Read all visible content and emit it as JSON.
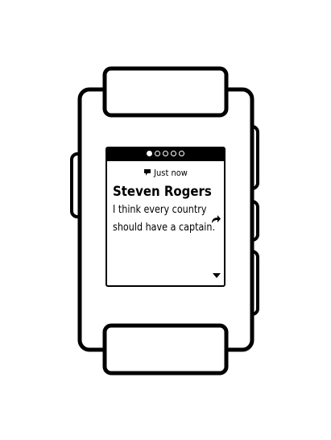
{
  "pagination": {
    "total": 5,
    "active_index": 0
  },
  "notification": {
    "icon": "speech-bubble-icon",
    "timestamp": "Just now",
    "sender": "Steven Rogers",
    "message": "I think every country should have a captain."
  },
  "icons": {
    "reply": "reply-arrow-icon",
    "scroll": "down-arrow-icon"
  },
  "colors": {
    "outline": "#000000",
    "background": "#ffffff",
    "status_bar": "#000000"
  }
}
